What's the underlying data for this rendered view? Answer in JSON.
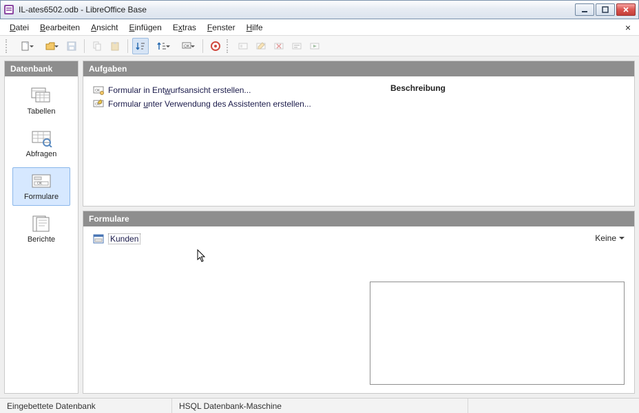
{
  "window": {
    "title": "IL-ates6502.odb - LibreOffice Base",
    "buttons": {
      "min": "–",
      "max": "□",
      "close": "✕"
    }
  },
  "menu": {
    "items": [
      {
        "pre": "",
        "u": "D",
        "post": "atei"
      },
      {
        "pre": "",
        "u": "B",
        "post": "earbeiten"
      },
      {
        "pre": "",
        "u": "A",
        "post": "nsicht"
      },
      {
        "pre": "",
        "u": "E",
        "post": "infügen"
      },
      {
        "pre": "E",
        "u": "x",
        "post": "tras"
      },
      {
        "pre": "",
        "u": "F",
        "post": "enster"
      },
      {
        "pre": "",
        "u": "H",
        "post": "ilfe"
      }
    ],
    "close_doc": "×"
  },
  "sidebar": {
    "title": "Datenbank",
    "items": [
      {
        "label": "Tabellen",
        "selected": false
      },
      {
        "label": "Abfragen",
        "selected": false
      },
      {
        "label": "Formulare",
        "selected": true
      },
      {
        "label": "Berichte",
        "selected": false
      }
    ]
  },
  "tasks": {
    "title": "Aufgaben",
    "items": [
      {
        "pre": "Formular in Ent",
        "u": "w",
        "post": "urfsansicht erstellen..."
      },
      {
        "pre": "Formular ",
        "u": "u",
        "post": "nter Verwendung des Assistenten erstellen..."
      }
    ],
    "descTitle": "Beschreibung"
  },
  "listPanel": {
    "title": "Formulare",
    "items": [
      {
        "label": "Kunden"
      }
    ],
    "viewLabel": "Keine"
  },
  "statusbar": {
    "left": "Eingebettete Datenbank",
    "mid": "HSQL Datenbank-Maschine"
  }
}
